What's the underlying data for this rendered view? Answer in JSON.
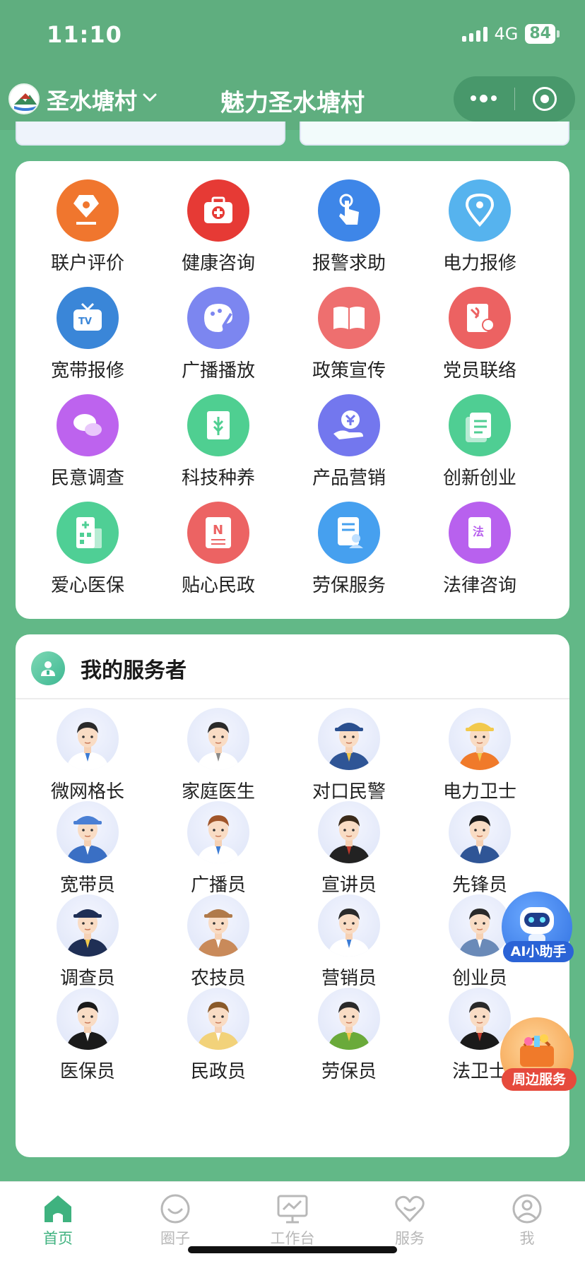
{
  "status_bar": {
    "time": "11:10",
    "network": "4G",
    "battery": "84"
  },
  "nav": {
    "village_name": "圣水塘村",
    "title": "魅力圣水塘村"
  },
  "services": [
    {
      "label": "联户评价",
      "icon": "pen-nib-icon",
      "color": "#f0762e"
    },
    {
      "label": "健康咨询",
      "icon": "first-aid-kit-icon",
      "color": "#e63a35"
    },
    {
      "label": "报警求助",
      "icon": "tap-hand-icon",
      "color": "#3e86e8"
    },
    {
      "label": "电力报修",
      "icon": "location-pin-icon",
      "color": "#56b3ee"
    },
    {
      "label": "宽带报修",
      "icon": "tv-icon",
      "color": "#3a86d8"
    },
    {
      "label": "广播播放",
      "icon": "palette-icon",
      "color": "#7c86f0"
    },
    {
      "label": "政策宣传",
      "icon": "open-book-icon",
      "color": "#ee6f6f"
    },
    {
      "label": "党员联络",
      "icon": "party-document-icon",
      "color": "#ec6262"
    },
    {
      "label": "民意调查",
      "icon": "chat-bubbles-icon",
      "color": "#bd63ee"
    },
    {
      "label": "科技种养",
      "icon": "wheat-book-icon",
      "color": "#4fcf91"
    },
    {
      "label": "产品营销",
      "icon": "yuan-hand-icon",
      "color": "#7377ee"
    },
    {
      "label": "创新创业",
      "icon": "document-stack-icon",
      "color": "#4fce93"
    },
    {
      "label": "爱心医保",
      "icon": "hospital-building-icon",
      "color": "#4fcf95"
    },
    {
      "label": "贴心民政",
      "icon": "newspaper-icon",
      "color": "#ec6363"
    },
    {
      "label": "劳保服务",
      "icon": "document-person-icon",
      "color": "#46a0ef"
    },
    {
      "label": "法律咨询",
      "icon": "law-book-icon",
      "color": "#b861ee"
    }
  ],
  "workers_section": {
    "title": "我的服务者"
  },
  "workers": [
    {
      "label": "微网格长",
      "avatar": "grid-leader-avatar"
    },
    {
      "label": "家庭医生",
      "avatar": "doctor-avatar"
    },
    {
      "label": "对口民警",
      "avatar": "police-avatar"
    },
    {
      "label": "电力卫士",
      "avatar": "electrician-avatar"
    },
    {
      "label": "宽带员",
      "avatar": "broadband-worker-avatar"
    },
    {
      "label": "广播员",
      "avatar": "broadcaster-avatar"
    },
    {
      "label": "宣讲员",
      "avatar": "lecturer-avatar"
    },
    {
      "label": "先锋员",
      "avatar": "pioneer-avatar"
    },
    {
      "label": "调查员",
      "avatar": "investigator-avatar"
    },
    {
      "label": "农技员",
      "avatar": "agri-technician-avatar"
    },
    {
      "label": "营销员",
      "avatar": "salesman-avatar"
    },
    {
      "label": "创业员",
      "avatar": "entrepreneur-avatar"
    },
    {
      "label": "医保员",
      "avatar": "medical-insurance-avatar"
    },
    {
      "label": "民政员",
      "avatar": "civil-affairs-avatar"
    },
    {
      "label": "劳保员",
      "avatar": "labor-insurance-avatar"
    },
    {
      "label": "法卫士",
      "avatar": "law-guard-avatar"
    }
  ],
  "floating": {
    "ai_assistant": "AI小助手",
    "nearby_services": "周边服务"
  },
  "tab_bar": [
    {
      "label": "首页",
      "icon": "home-icon",
      "active": true
    },
    {
      "label": "圈子",
      "icon": "circle-chat-icon",
      "active": false
    },
    {
      "label": "工作台",
      "icon": "workbench-chart-icon",
      "active": false
    },
    {
      "label": "服务",
      "icon": "heart-icon",
      "active": false
    },
    {
      "label": "我",
      "icon": "user-icon",
      "active": false
    }
  ],
  "colors": {
    "primary": "#5fae7f",
    "page_background": "#62b887",
    "active_tab": "#3fb27f",
    "inactive_tab": "#b8b8b8"
  }
}
